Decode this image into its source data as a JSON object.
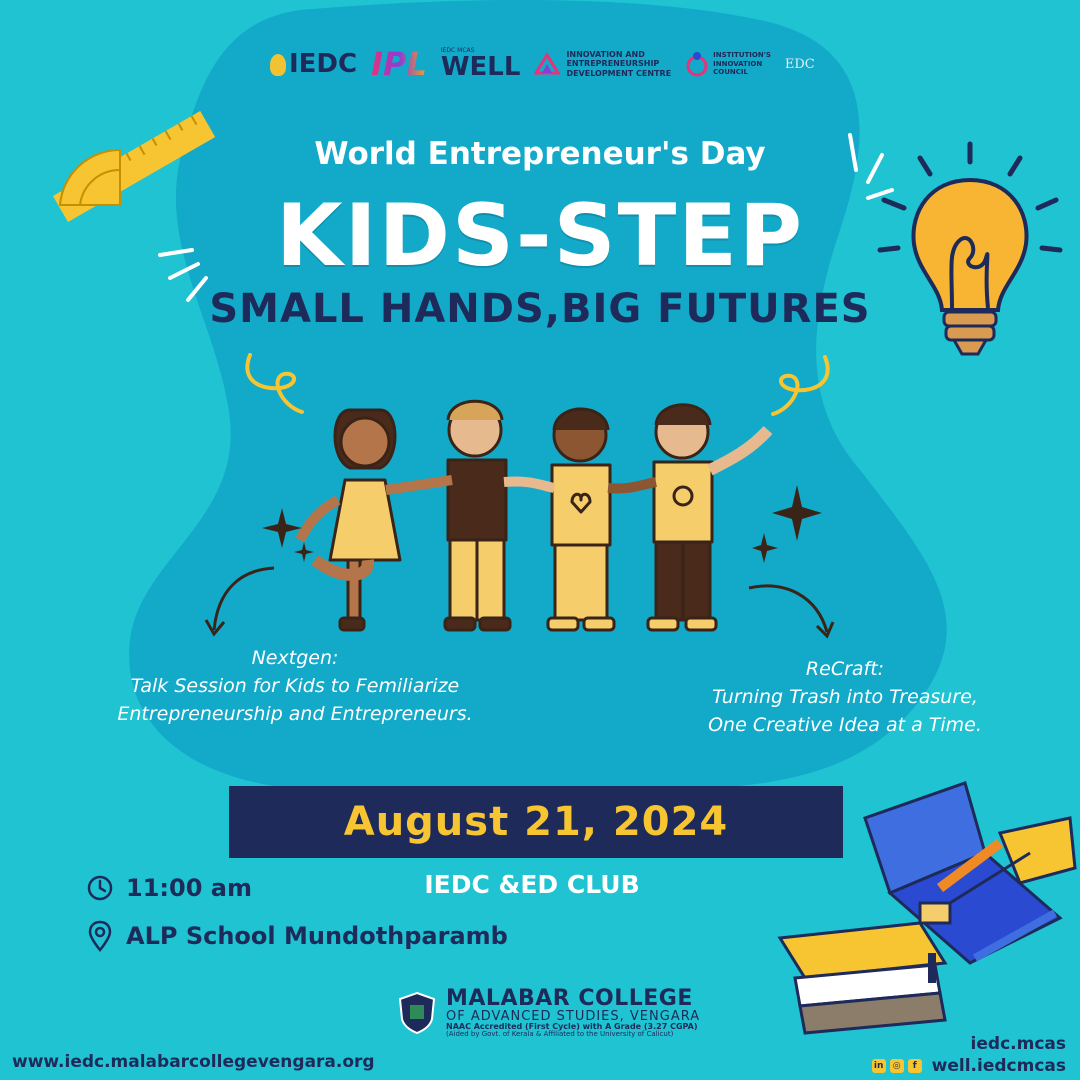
{
  "colors": {
    "background": "#1fc3d1",
    "blob": "#13a9c9",
    "navy": "#1d2a5a",
    "yellow": "#f6c531",
    "white": "#ffffff"
  },
  "logos": {
    "iedc": "IEDC",
    "iedc_sub": "MCAS",
    "ipl": "IPL",
    "well": "WELL",
    "well_top": "IEDC MCAS",
    "innovation_centre": "INNOVATION AND\nENTREPRENEURSHIP\nDEVELOPMENT CENTRE",
    "iic": "INSTITUTION'S\nINNOVATION\nCOUNCIL",
    "edc": "EDC"
  },
  "subtitle": "World Entrepreneur's Day",
  "title": "KIDS-STEP",
  "tagline": "SMALL HANDS,BIG FUTURES",
  "sessions": {
    "nextgen": {
      "heading": "Nextgen:",
      "line1": "Talk Session for Kids to Femiliarize",
      "line2": "Entrepreneurship and Entrepreneurs."
    },
    "recraft": {
      "heading": "ReCraft:",
      "line1": "Turning Trash into Treasure,",
      "line2": "One Creative Idea at a Time."
    }
  },
  "date": "August 21, 2024",
  "organizer": "IEDC &ED CLUB",
  "time": "11:00 am",
  "venue": "ALP School Mundothparamb",
  "college": {
    "line1": "MALABAR COLLEGE",
    "line2": "OF ADVANCED STUDIES, VENGARA",
    "line3": "NAAC Accredited (First Cycle) with A Grade (3.27 CGPA)",
    "line4": "(Aided by Govt. of Kerala & Affiliated to the University of Calicut)"
  },
  "website": "www.iedc.malabarcollegevengara.org",
  "handles": {
    "first": "iedc.mcas",
    "second": "well.iedcmcas"
  },
  "icons": [
    "clock-icon",
    "location-pin-icon",
    "linkedin-icon",
    "instagram-icon",
    "facebook-icon",
    "light-bulb-icon",
    "ruler-icon",
    "pencil-case-icon"
  ]
}
